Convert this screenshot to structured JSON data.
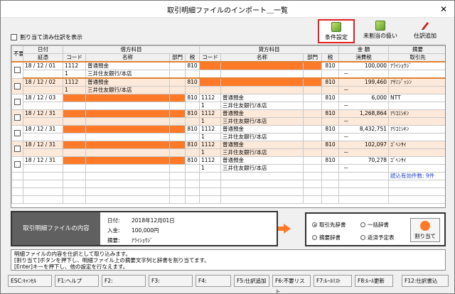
{
  "window": {
    "title": "取引明細ファイルのインポート＿一覧",
    "close_glyph": "✕"
  },
  "filter_checkbox_label": "割り当て済み仕訳を表示",
  "toolbar": {
    "conditions": "条件設定",
    "unassigned": "未割当の扱い",
    "add_entry": "仕訳追加"
  },
  "table": {
    "h_fuyou": "不要",
    "h_date": "日付",
    "h_shohyo": "証憑",
    "h_debit": "借方科目",
    "h_credit": "貸方科目",
    "h_code": "コード",
    "h_name": "名称",
    "h_dept": "部門",
    "h_tax": "税",
    "h_amount": "金 額",
    "h_ctax": "消費税",
    "h_summary": "摘要",
    "h_partner": "取引先",
    "entries": [
      {
        "date": "18 / 12 / 01",
        "d_code": "1112",
        "d_name": "普通預金",
        "d_tax": "810",
        "c_code": "",
        "c_name": "",
        "c_tax": "810",
        "amount": "100,000",
        "partner": "ｱﾗｲｼｮｳｼﾞ",
        "sub_code": "1",
        "sub_name": "三井住友銀行/本店",
        "sub_tax": "",
        "sub_side": "debit",
        "dash": "－"
      },
      {
        "date": "18 / 12 / 02",
        "d_code": "1112",
        "d_name": "普通預金",
        "d_tax": "810",
        "c_code": "",
        "c_name": "",
        "c_tax": "810",
        "amount": "199,460",
        "partner": "ｱｻﾐｼﾞｯｼﾝ",
        "sub_code": "1",
        "sub_name": "三井住友銀行/本店",
        "sub_tax": "",
        "sub_side": "debit",
        "dash": "－"
      },
      {
        "date": "18 / 12 / 03",
        "d_code": "",
        "d_name": "",
        "d_tax": "810",
        "c_code": "1112",
        "c_name": "普通預金",
        "c_tax": "810",
        "amount": "6,000",
        "partner": "NTT",
        "sub_code": "1",
        "sub_name": "三井住友銀行/本店",
        "sub_tax": "",
        "sub_side": "credit",
        "dash": "－"
      },
      {
        "date": "18 / 12 / 31",
        "d_code": "",
        "d_name": "",
        "d_tax": "810",
        "c_code": "1112",
        "c_name": "普通預金",
        "c_tax": "810",
        "amount": "1,268,864",
        "partner": "ｱﾘｺﾐｼｷﾝ",
        "sub_code": "1",
        "sub_name": "三井住友銀行/本店",
        "sub_tax": "",
        "sub_side": "credit",
        "dash": "－"
      },
      {
        "date": "18 / 12 / 31",
        "d_code": "",
        "d_name": "",
        "d_tax": "810",
        "c_code": "1112",
        "c_name": "普通預金",
        "c_tax": "810",
        "amount": "8,432,751",
        "partner": "ｱﾘｺﾐｼｷﾝ",
        "sub_code": "1",
        "sub_name": "三井住友銀行/本店",
        "sub_tax": "",
        "sub_side": "credit",
        "dash": "－"
      },
      {
        "date": "18 / 12 / 31",
        "d_code": "",
        "d_name": "",
        "d_tax": "810",
        "c_code": "1112",
        "c_name": "普通預金",
        "c_tax": "810",
        "amount": "102,097",
        "partner": "ｺﾞﾍﾝｻｲ",
        "sub_code": "1",
        "sub_name": "三井住友銀行/本店",
        "sub_tax": "",
        "sub_side": "credit",
        "dash": "－"
      },
      {
        "date": "18 / 12 / 31",
        "d_code": "",
        "d_name": "",
        "d_tax": "810",
        "c_code": "1112",
        "c_name": "普通預金",
        "c_tax": "810",
        "amount": "70,278",
        "partner": "ｺﾞﾍﾝｻｲ",
        "sub_code": "1",
        "sub_name": "三井住友銀行/本店",
        "sub_tax": "",
        "sub_side": "credit",
        "dash": "－"
      }
    ],
    "count_text": "読込有効件数: 9件"
  },
  "info": {
    "label": "取引明細ファイルの内容",
    "date_key": "日付:",
    "date_val": "2018年12月01日",
    "amount_key": "入金:",
    "amount_val": "100,000円",
    "summary_key": "摘要:",
    "summary_val": "ｱﾗｲｼｮｳｼﾞ"
  },
  "options": {
    "partner_dict": "取引先辞書",
    "bulk_dict": "一括辞書",
    "summary_dict": "摘要辞書",
    "refund_table": "返済予定表",
    "assign_button": "割り当て"
  },
  "message": [
    "明細ファイルの内容を仕訳として取り込みます。",
    "[割り当て]ボタンを押下し、明細ファイル上の摘要文字列と辞書を割り当てます。",
    "[Enter]キーを押下し、他の設定を行なえます。"
  ],
  "fkeys": [
    "ESC:ｷｬﾝｾﾙ",
    "F1:ヘルプ",
    "F2:",
    "F3:",
    "F4:",
    "F5:仕訳追加",
    "F6:不要リスト",
    "F7:ﾙｰﾙﾘｽﾄ",
    "F8:ﾙｰﾙ更新",
    "F12:仕訳書込"
  ],
  "colors": {
    "highlight": "#ff7a28",
    "row_alt": "#fde9d9",
    "count_text": "#1a3ecf",
    "focus_border": "#e02020"
  }
}
